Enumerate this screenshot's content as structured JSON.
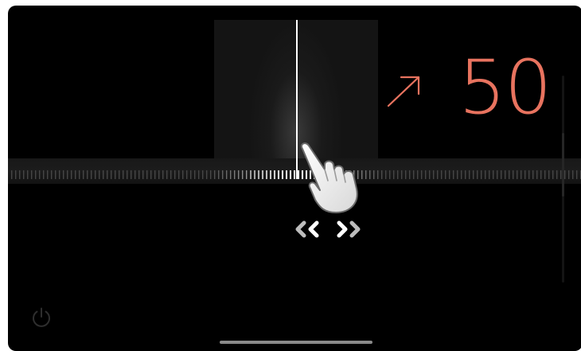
{
  "screen": {
    "value_display": "50",
    "trend_icon": "arrow-up-right-icon",
    "gesture_icon": "pointing-hand-icon",
    "swipe_hint_icon": "left-right-chevrons-icon",
    "power_icon": "power-icon"
  },
  "colors": {
    "accent": "#e8735f",
    "background": "#000000",
    "indicator": "#ffffff"
  }
}
